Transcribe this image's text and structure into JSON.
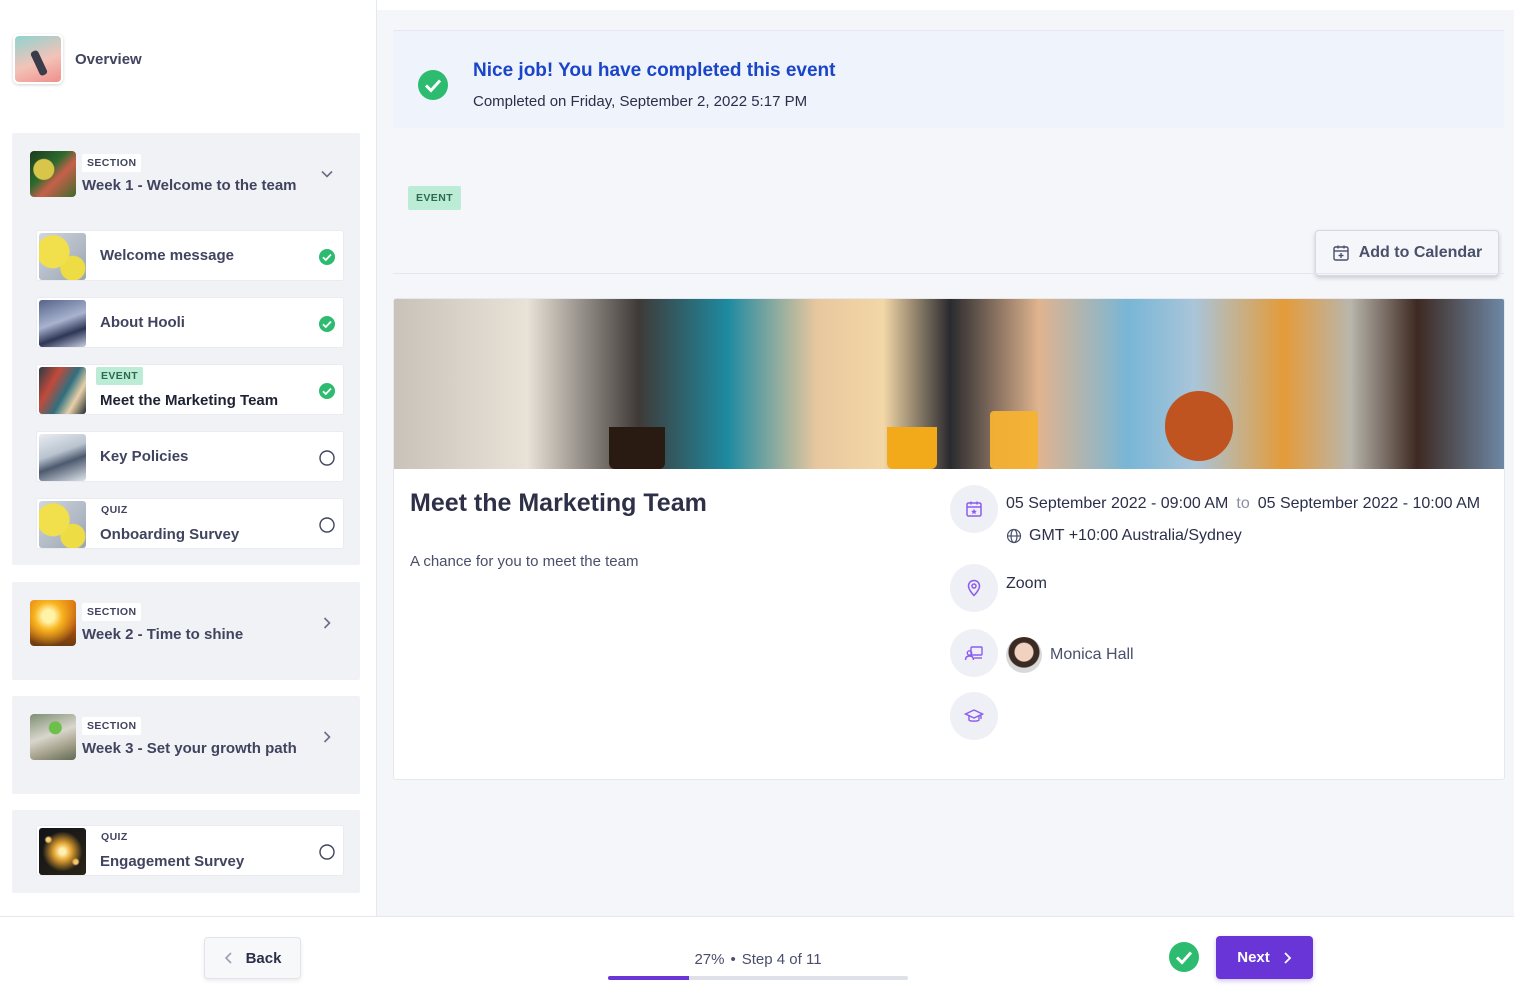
{
  "sidebar": {
    "overview_label": "Overview",
    "groups": [
      {
        "tag": "SECTION",
        "title": "Week 1 - Welcome to the team",
        "items": [
          {
            "name": "Welcome message",
            "tag": "",
            "status": "complete"
          },
          {
            "name": "About Hooli",
            "tag": "",
            "status": "complete"
          },
          {
            "name": "Meet the Marketing Team",
            "tag": "EVENT",
            "status": "complete"
          },
          {
            "name": "Key Policies",
            "tag": "",
            "status": "incomplete"
          },
          {
            "name": "Onboarding Survey",
            "tag": "QUIZ",
            "status": "incomplete"
          }
        ]
      },
      {
        "tag": "SECTION",
        "title": "Week 2 - Time to shine"
      },
      {
        "tag": "SECTION",
        "title": "Week 3 - Set your growth path"
      },
      {
        "tag": "QUIZ",
        "title": "Engagement Survey",
        "status": "incomplete"
      }
    ]
  },
  "banner": {
    "title": "Nice job! You have completed this event",
    "subtitle": "Completed on Friday, September 2, 2022 5:17 PM"
  },
  "event": {
    "tag": "EVENT",
    "add_to_calendar": "Add to Calendar",
    "title": "Meet the Marketing Team",
    "description": "A chance for you to meet the team",
    "start": "05 September 2022 - 09:00 AM",
    "to": "to",
    "end": "05 September 2022 - 10:00 AM",
    "timezone": "GMT +10:00 Australia/Sydney",
    "location": "Zoom",
    "host": "Monica Hall"
  },
  "footer": {
    "back_label": "Back",
    "progress_percent": "27%",
    "progress_fraction": 0.27,
    "step_text": "Step 4 of 11",
    "next_label": "Next"
  },
  "colors": {
    "accent": "#6a35d6",
    "success": "#2dbb6f",
    "banner_title": "#1b45c8"
  }
}
